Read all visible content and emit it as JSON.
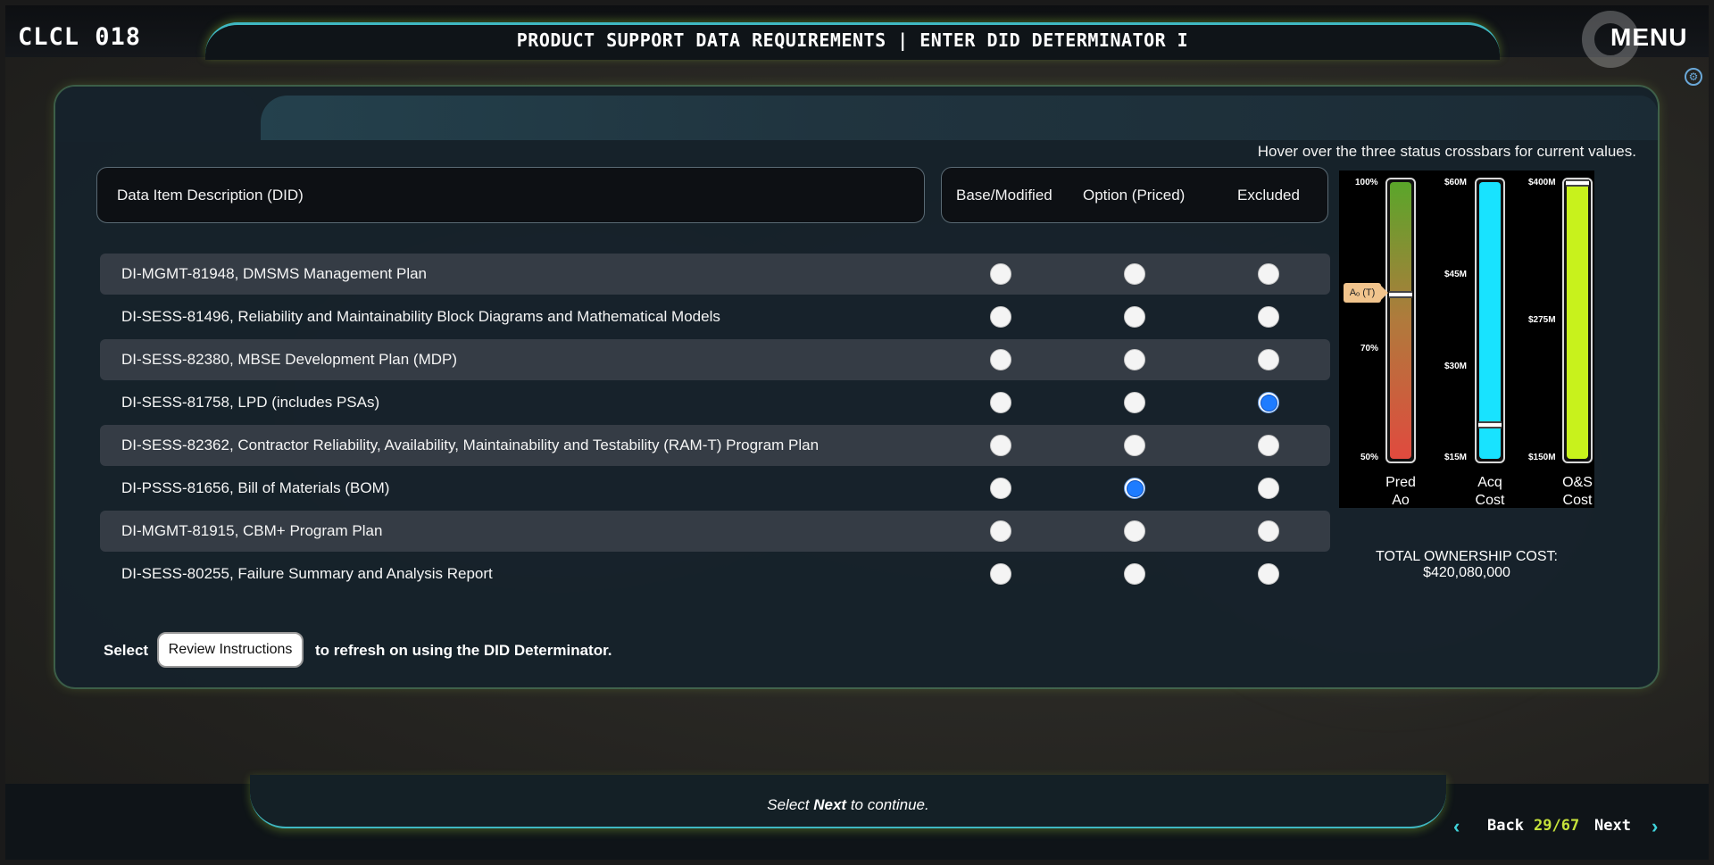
{
  "header": {
    "course_id": "CLCL 018",
    "title": "PRODUCT SUPPORT DATA REQUIREMENTS | ENTER DID DETERMINATOR I",
    "menu_label": "MENU"
  },
  "hint": "Hover over the three status crossbars for current values.",
  "table": {
    "did_header": "Data Item Description (DID)",
    "option_headers": [
      "Base/Modified",
      "Option (Priced)",
      "Excluded"
    ],
    "rows": [
      {
        "label": "DI-MGMT-81948, DMSMS Management Plan",
        "selected": null
      },
      {
        "label": "DI-SESS-81496, Reliability and Maintainability Block Diagrams and Mathematical Models",
        "selected": null
      },
      {
        "label": "DI-SESS-82380, MBSE Development Plan (MDP)",
        "selected": null
      },
      {
        "label": "DI-SESS-81758, LPD (includes PSAs)",
        "selected": "Excluded"
      },
      {
        "label": "DI-SESS-82362, Contractor Reliability, Availability, Maintainability and Testability (RAM-T) Program Plan",
        "selected": null
      },
      {
        "label": "DI-PSSS-81656, Bill of Materials (BOM)",
        "selected": "Option (Priced)"
      },
      {
        "label": "DI-MGMT-81915, CBM+ Program Plan",
        "selected": null
      },
      {
        "label": "DI-SESS-80255, Failure Summary and Analysis Report",
        "selected": null
      }
    ]
  },
  "instructions": {
    "pre": "Select",
    "button": "Review Instructions",
    "post": "to refresh on using the DID Determinator."
  },
  "gauges": {
    "pred_ao": {
      "ticks": [
        "100%",
        "70%",
        "50%"
      ],
      "label_line1": "Pred",
      "label_line2": "Ao",
      "threshold_tag": "Aₒ (T)",
      "colors": [
        "#5aa62a",
        "#b07a3c",
        "#e04a3e"
      ],
      "level": 0.6
    },
    "acq_cost": {
      "ticks": [
        "$60M",
        "$45M",
        "$30M",
        "$15M"
      ],
      "label_line1": "Acq",
      "label_line2": "Cost",
      "color": "#18e3ff",
      "level": 0.13
    },
    "os_cost": {
      "ticks": [
        "$400M",
        "$275M",
        "$150M"
      ],
      "label_line1": "O&S",
      "label_line2": "Cost",
      "color": "#c8f21c",
      "level": 1.0
    }
  },
  "total_ownership_cost": "TOTAL OWNERSHIP COST: $420,080,000",
  "footer": {
    "continue_pre": "Select ",
    "continue_bold": "Next",
    "continue_post": " to continue.",
    "back_label": "Back",
    "page_count": "29/67",
    "next_label": "Next"
  }
}
